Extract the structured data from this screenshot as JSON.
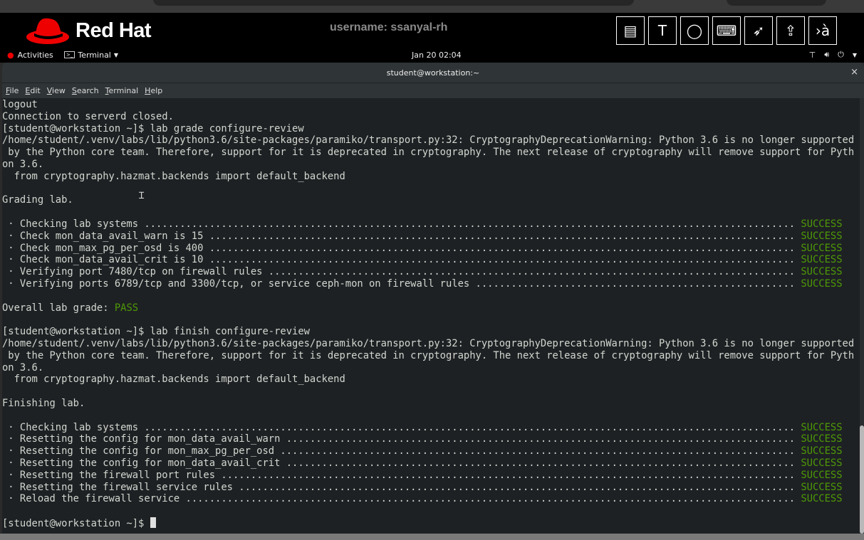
{
  "banner": {
    "brand": "Red Hat",
    "username": "username: ssanyal-rh",
    "tools": [
      {
        "icon": "document-icon",
        "glyph": "▤"
      },
      {
        "icon": "text-icon",
        "glyph": "T"
      },
      {
        "icon": "refresh-icon",
        "glyph": "◯"
      },
      {
        "icon": "keyboard-icon",
        "glyph": "⌨"
      },
      {
        "icon": "pointer-disabled-icon",
        "glyph": "➶"
      },
      {
        "icon": "upload-laptop-icon",
        "glyph": "⇪"
      },
      {
        "icon": "input-method-icon",
        "glyph": "›à"
      }
    ]
  },
  "topbar": {
    "activities": "Activities",
    "app": "Terminal",
    "clock": "Jan 20  02:04"
  },
  "window": {
    "title": "student@workstation:~",
    "close": "×"
  },
  "menu": [
    {
      "key": "F",
      "rest": "ile"
    },
    {
      "key": "E",
      "rest": "dit"
    },
    {
      "key": "V",
      "rest": "iew"
    },
    {
      "key": "S",
      "rest": "earch"
    },
    {
      "key": "T",
      "rest": "erminal"
    },
    {
      "key": "H",
      "rest": "elp"
    }
  ],
  "colors": {
    "success": "#4e9a06",
    "terminal_bg": "#1e2124"
  },
  "terminal": {
    "lines": [
      {
        "t": "logout"
      },
      {
        "t": "Connection to serverd closed."
      },
      {
        "t": "[student@workstation ~]$ lab grade configure-review"
      },
      {
        "t": "/home/student/.venv/labs/lib/python3.6/site-packages/paramiko/transport.py:32: CryptographyDeprecationWarning: Python 3.6 is no longer supported"
      },
      {
        "t": " by the Python core team. Therefore, support for it is deprecated in cryptography. The next release of cryptography will remove support for Pyth"
      },
      {
        "t": "on 3.6."
      },
      {
        "t": "  from cryptography.hazmat.backends import default_backend"
      },
      {
        "t": ""
      },
      {
        "t": "Grading lab."
      },
      {
        "t": ""
      },
      {
        "check": " · Checking lab systems",
        "status": "SUCCESS"
      },
      {
        "check": " · Check mon_data_avail_warn is 15",
        "status": "SUCCESS"
      },
      {
        "check": " · Check mon_max_pg_per_osd is 400",
        "status": "SUCCESS"
      },
      {
        "check": " · Check mon_data_avail_crit is 10",
        "status": "SUCCESS"
      },
      {
        "check": " · Verifying port 7480/tcp on firewall rules",
        "status": "SUCCESS"
      },
      {
        "check": " · Verifying ports 6789/tcp and 3300/tcp, or service ceph-mon on firewall rules",
        "status": "SUCCESS"
      },
      {
        "t": ""
      },
      {
        "t": "Overall lab grade: ",
        "ok": "PASS"
      },
      {
        "t": ""
      },
      {
        "t": "[student@workstation ~]$ lab finish configure-review"
      },
      {
        "t": "/home/student/.venv/labs/lib/python3.6/site-packages/paramiko/transport.py:32: CryptographyDeprecationWarning: Python 3.6 is no longer supported"
      },
      {
        "t": " by the Python core team. Therefore, support for it is deprecated in cryptography. The next release of cryptography will remove support for Pyth"
      },
      {
        "t": "on 3.6."
      },
      {
        "t": "  from cryptography.hazmat.backends import default_backend"
      },
      {
        "t": ""
      },
      {
        "t": "Finishing lab."
      },
      {
        "t": ""
      },
      {
        "check": " · Checking lab systems",
        "status": "SUCCESS"
      },
      {
        "check": " · Resetting the config for mon_data_avail_warn",
        "status": "SUCCESS"
      },
      {
        "check": " · Resetting the config for mon_max_pg_per_osd",
        "status": "SUCCESS"
      },
      {
        "check": " · Resetting the config for mon_data_avail_crit",
        "status": "SUCCESS"
      },
      {
        "check": " · Resetting the firewall port rules",
        "status": "SUCCESS"
      },
      {
        "check": " · Resetting the firewall service rules",
        "status": "SUCCESS"
      },
      {
        "check": " · Reload the firewall service",
        "status": "SUCCESS"
      },
      {
        "t": ""
      },
      {
        "t": "[student@workstation ~]$ ",
        "cursor": true
      }
    ]
  }
}
